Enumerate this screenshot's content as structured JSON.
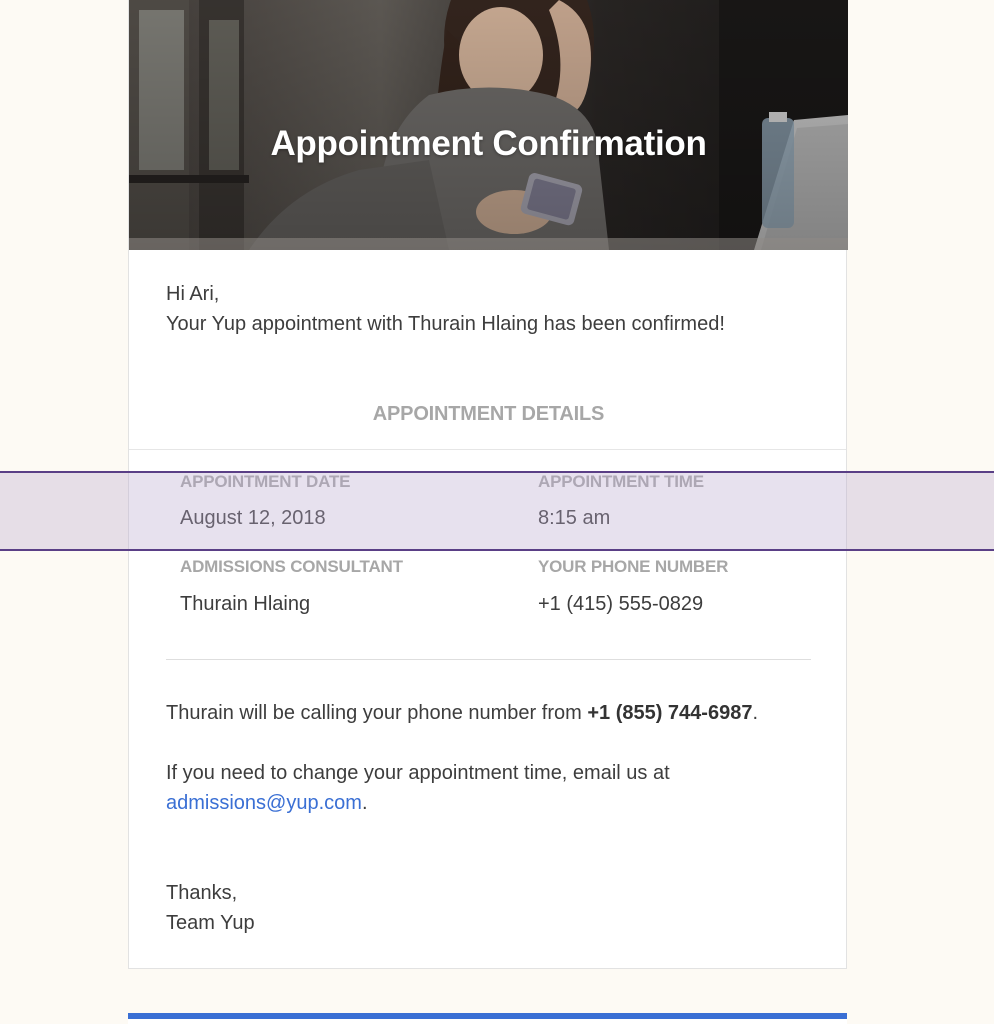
{
  "hero": {
    "title": "Appointment Confirmation",
    "image": "woman-looking-at-phone-photo"
  },
  "message": {
    "greeting": "Hi Ari,",
    "confirmation": "Your Yup appointment with Thurain Hlaing has been confirmed!"
  },
  "details": {
    "section_title": "APPOINTMENT DETAILS",
    "date_label": "APPOINTMENT DATE",
    "date_value": "August 12, 2018",
    "time_label": "APPOINTMENT TIME",
    "time_value": "8:15 am",
    "consultant_label": "ADMISSIONS CONSULTANT",
    "consultant_value": "Thurain Hlaing",
    "phone_label": "YOUR PHONE NUMBER",
    "phone_value": "+1 (415) 555-0829"
  },
  "calling": {
    "prefix": "Thurain will be calling your phone number from ",
    "number": "+1 (855) 744-6987",
    "suffix": "."
  },
  "change": {
    "line1": "If you need to change your appointment time, email us at",
    "email": "admissions@yup.com",
    "suffix": "."
  },
  "signoff": {
    "thanks": "Thanks,",
    "team": "Team Yup"
  },
  "colors": {
    "page_background": "#fdfaf4",
    "label_gray": "#a7a7a7",
    "link_blue": "#3a6fd4",
    "highlight_border": "#5a3f86"
  }
}
